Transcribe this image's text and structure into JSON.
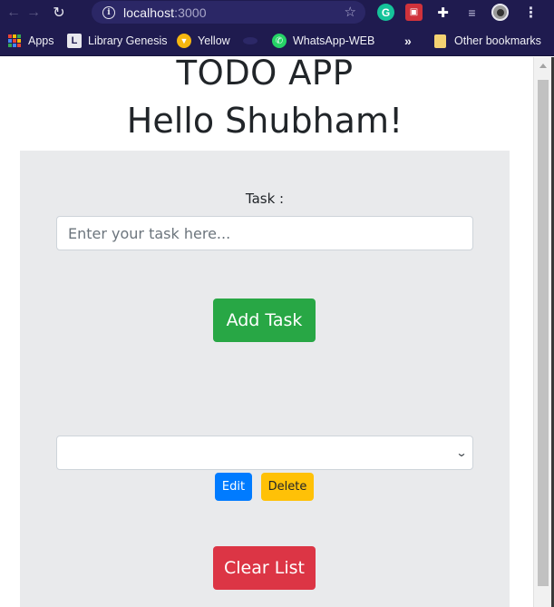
{
  "browser": {
    "url_host": "localhost",
    "url_port": ":3000",
    "bookmarks": {
      "apps": "Apps",
      "library_genesis": "Library Genesis",
      "yellow": "Yellow",
      "whatsapp": "WhatsApp-WEB",
      "more": "»",
      "other": "Other bookmarks"
    },
    "icons": {
      "back": "←",
      "forward": "→",
      "reload": "↻",
      "info": "i",
      "star": "☆",
      "grammarly": "G",
      "puzzle": "✚",
      "media": "≡",
      "menu": "⋮"
    }
  },
  "app": {
    "title": "TODO APP",
    "greeting": "Hello Shubham!",
    "task_label": "Task :",
    "task_input": {
      "value": "",
      "placeholder": "Enter your task here..."
    },
    "add_button": "Add Task",
    "task_select": {
      "selected": ""
    },
    "edit_button": "Edit",
    "delete_button": "Delete",
    "clear_button": "Clear List"
  },
  "colors": {
    "browser_chrome": "#1f1b4f",
    "card_bg": "#e9eaec",
    "success": "#28a745",
    "primary": "#007bff",
    "warning": "#ffc107",
    "danger": "#dc3545"
  }
}
